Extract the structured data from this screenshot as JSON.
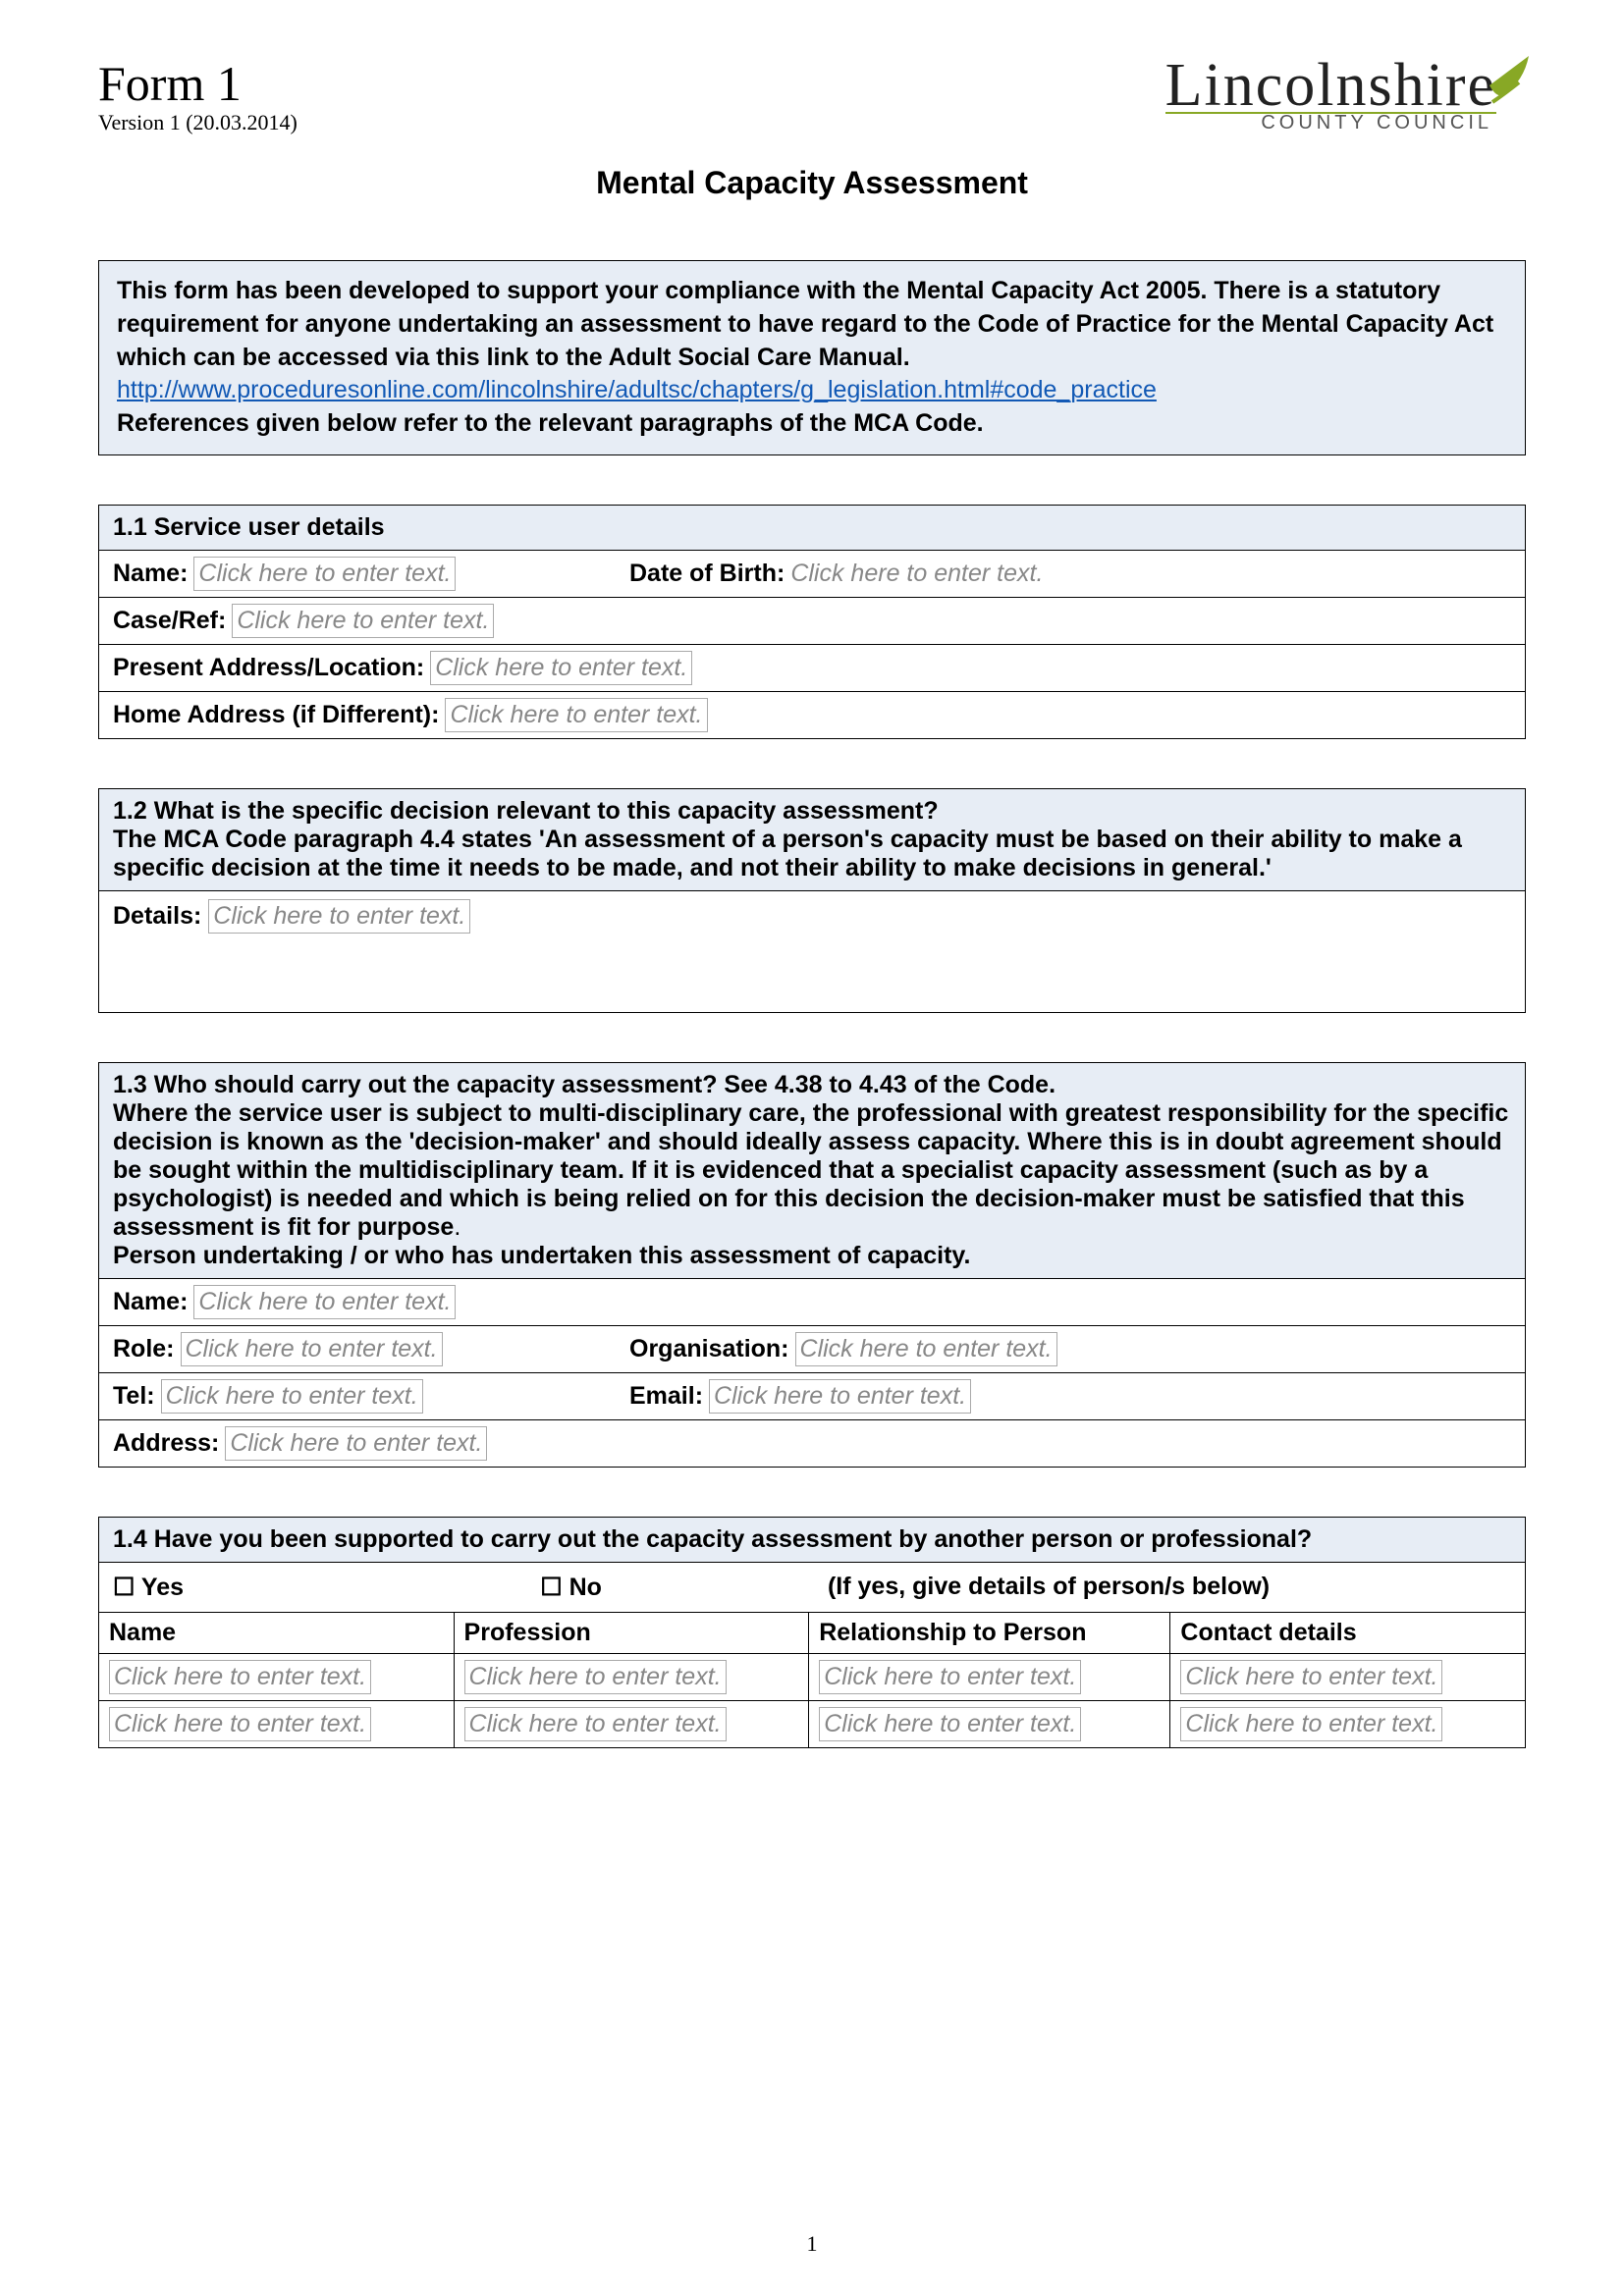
{
  "header": {
    "form": "Form 1",
    "version": "Version 1 (20.03.2014)",
    "logo_line1": "Lincolnshire",
    "logo_line2": "COUNTY COUNCIL"
  },
  "title": "Mental Capacity Assessment",
  "intro": {
    "p1": "This form has been developed to support your compliance with the Mental Capacity Act 2005. There is a statutory requirement for anyone undertaking an assessment to have regard to the Code of Practice for the Mental Capacity Act which can be accessed via this link to the Adult Social Care Manual.",
    "link": "http://www.proceduresonline.com/lincolnshire/adultsc/chapters/g_legislation.html#code_practice",
    "p2": "References given below refer to the relevant paragraphs of the MCA Code."
  },
  "s11": {
    "heading": "1.1 Service user details",
    "name_label": "Name:",
    "dob_label": "Date of Birth:",
    "caseref_label": "Case/Ref:",
    "present_label": "Present Address/Location:",
    "home_label": "Home Address (if Different):",
    "placeholder": "Click here to enter text."
  },
  "s12": {
    "heading": "1.2 What is the specific decision relevant to this capacity assessment?",
    "note": "The MCA Code paragraph 4.4 states 'An assessment of a person's capacity must be based on their ability to make a specific decision at the time it needs to be made, and not their ability to make decisions in general.'",
    "details_label": "Details:",
    "placeholder": "Click here to enter text."
  },
  "s13": {
    "heading": "1.3 Who should carry out the capacity assessment? See 4.38 to 4.43 of the Code.",
    "body1": "Where the service user is subject to multi-disciplinary care, the professional with greatest responsibility for the specific decision is known as the 'decision-maker' and should ideally assess capacity. Where this is in doubt agreement should be sought within the multidisciplinary team. If it is evidenced that a specialist capacity assessment (such as by a psychologist) is needed and which is being relied on for this decision the decision-maker must be satisfied that this assessment is fit for purpose",
    "body2": "Person undertaking / or who has undertaken this assessment of capacity.",
    "name_label": "Name:",
    "role_label": "Role:",
    "org_label": "Organisation:",
    "tel_label": "Tel:",
    "email_label": "Email:",
    "address_label": "Address:",
    "placeholder": "Click here to enter text."
  },
  "s14": {
    "heading": "1.4 Have you been supported to carry out the capacity assessment by another person or professional?",
    "yes": "Yes",
    "no": "No",
    "hint": "(If yes, give details of person/s below)",
    "cols": [
      "Name",
      "Profession",
      "Relationship to Person",
      "Contact details"
    ],
    "placeholder": "Click here to enter text."
  },
  "page_number": "1"
}
